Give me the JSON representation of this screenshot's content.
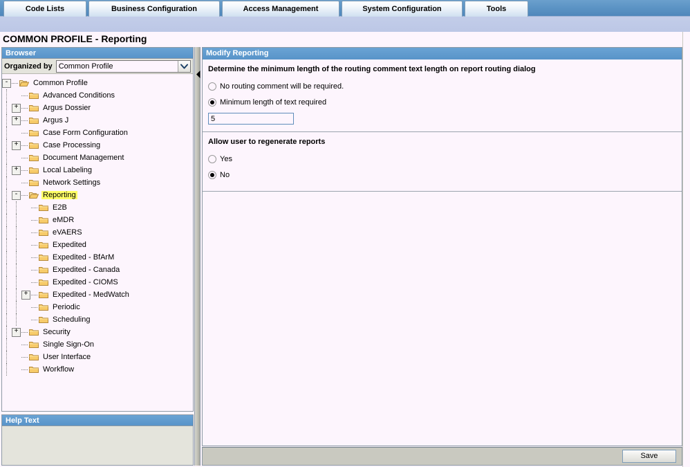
{
  "nav": {
    "tabs": [
      {
        "id": "code-lists",
        "label": "Code Lists"
      },
      {
        "id": "business-configuration",
        "label": "Business Configuration"
      },
      {
        "id": "access-management",
        "label": "Access Management"
      },
      {
        "id": "system-configuration",
        "label": "System Configuration"
      },
      {
        "id": "tools",
        "label": "Tools"
      }
    ]
  },
  "page": {
    "title": "COMMON PROFILE - Reporting"
  },
  "browser": {
    "header": "Browser",
    "organized_by_label": "Organized by",
    "organized_by_value": "Common Profile",
    "organized_by_options": [
      "Common Profile"
    ],
    "tree": [
      {
        "label": "Common Profile",
        "depth": 0,
        "toggle": "-",
        "open": true,
        "selected": false
      },
      {
        "label": "Advanced Conditions",
        "depth": 1,
        "toggle": "",
        "open": false,
        "selected": false
      },
      {
        "label": "Argus Dossier",
        "depth": 1,
        "toggle": "+",
        "open": false,
        "selected": false
      },
      {
        "label": "Argus J",
        "depth": 1,
        "toggle": "+",
        "open": false,
        "selected": false
      },
      {
        "label": "Case Form Configuration",
        "depth": 1,
        "toggle": "",
        "open": false,
        "selected": false
      },
      {
        "label": "Case Processing",
        "depth": 1,
        "toggle": "+",
        "open": false,
        "selected": false
      },
      {
        "label": "Document Management",
        "depth": 1,
        "toggle": "",
        "open": false,
        "selected": false
      },
      {
        "label": "Local Labeling",
        "depth": 1,
        "toggle": "+",
        "open": false,
        "selected": false
      },
      {
        "label": "Network Settings",
        "depth": 1,
        "toggle": "",
        "open": false,
        "selected": false
      },
      {
        "label": "Reporting",
        "depth": 1,
        "toggle": "-",
        "open": true,
        "selected": true
      },
      {
        "label": "E2B",
        "depth": 2,
        "toggle": "",
        "open": false,
        "selected": false
      },
      {
        "label": "eMDR",
        "depth": 2,
        "toggle": "",
        "open": false,
        "selected": false
      },
      {
        "label": "eVAERS",
        "depth": 2,
        "toggle": "",
        "open": false,
        "selected": false
      },
      {
        "label": "Expedited",
        "depth": 2,
        "toggle": "",
        "open": false,
        "selected": false
      },
      {
        "label": "Expedited - BfArM",
        "depth": 2,
        "toggle": "",
        "open": false,
        "selected": false
      },
      {
        "label": "Expedited - Canada",
        "depth": 2,
        "toggle": "",
        "open": false,
        "selected": false
      },
      {
        "label": "Expedited - CIOMS",
        "depth": 2,
        "toggle": "",
        "open": false,
        "selected": false
      },
      {
        "label": "Expedited - MedWatch",
        "depth": 2,
        "toggle": "+",
        "open": false,
        "selected": false
      },
      {
        "label": "Periodic",
        "depth": 2,
        "toggle": "",
        "open": false,
        "selected": false
      },
      {
        "label": "Scheduling",
        "depth": 2,
        "toggle": "",
        "open": false,
        "selected": false
      },
      {
        "label": "Security",
        "depth": 1,
        "toggle": "+",
        "open": false,
        "selected": false
      },
      {
        "label": "Single Sign-On",
        "depth": 1,
        "toggle": "",
        "open": false,
        "selected": false
      },
      {
        "label": "User Interface",
        "depth": 1,
        "toggle": "",
        "open": false,
        "selected": false
      },
      {
        "label": "Workflow",
        "depth": 1,
        "toggle": "",
        "open": false,
        "selected": false
      }
    ]
  },
  "help": {
    "header": "Help Text",
    "body": ""
  },
  "content": {
    "header": "Modify Reporting",
    "sections": [
      {
        "id": "routing-comment-length",
        "title": "Determine the minimum length of the routing comment text length on report routing dialog",
        "radios": [
          {
            "id": "no-routing-comment",
            "label": "No routing comment will be required.",
            "checked": false
          },
          {
            "id": "minimum-length",
            "label": "Minimum length of text required",
            "checked": true
          }
        ],
        "input": {
          "id": "minimum-length-input",
          "value": "5",
          "placeholder": ""
        }
      },
      {
        "id": "allow-regenerate-reports",
        "title": "Allow user to regenerate reports",
        "radios": [
          {
            "id": "regenerate-yes",
            "label": "Yes",
            "checked": false
          },
          {
            "id": "regenerate-no",
            "label": "No",
            "checked": true
          }
        ]
      }
    ]
  },
  "footer": {
    "save_label": "Save"
  },
  "colors": {
    "tabbar_blue": "#5894c9",
    "panel_header_blue": "#5e9bd1",
    "subbar_lavender": "#c3cde9",
    "page_background": "#fdf5fd",
    "selection_highlight": "#ffff66",
    "folder_yellow": "#f5c452",
    "footer_gray": "#c9c9c0"
  }
}
